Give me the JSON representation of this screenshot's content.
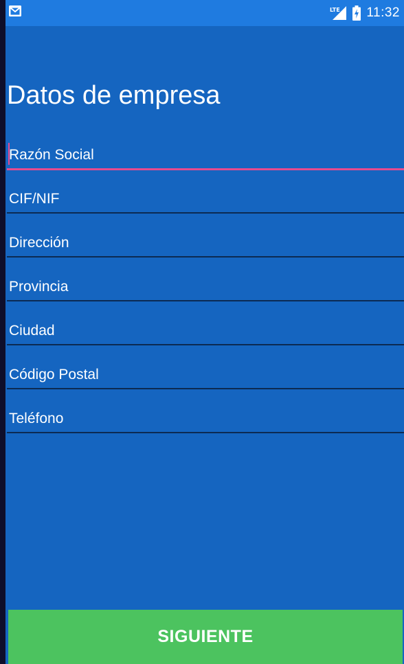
{
  "status_bar": {
    "notification_icon": "gmail-icon",
    "network_icon": "lte-signal-icon",
    "network_label": "LTE",
    "battery_icon": "battery-charging-icon",
    "time": "11:32"
  },
  "page": {
    "title": "Datos de empresa"
  },
  "form": {
    "fields": [
      {
        "placeholder": "Razón Social",
        "value": "",
        "active": true
      },
      {
        "placeholder": "CIF/NIF",
        "value": ""
      },
      {
        "placeholder": "Dirección",
        "value": ""
      },
      {
        "placeholder": "Provincia",
        "value": ""
      },
      {
        "placeholder": "Ciudad",
        "value": ""
      },
      {
        "placeholder": "Código Postal",
        "value": ""
      },
      {
        "placeholder": "Teléfono",
        "value": ""
      }
    ]
  },
  "actions": {
    "next_label": "SIGUIENTE"
  },
  "colors": {
    "background": "#1565c0",
    "status_bar": "#1f7be0",
    "accent_underline": "#e54b8f",
    "divider": "#0c2a52",
    "button": "#4cc35f",
    "text": "#ffffff"
  }
}
